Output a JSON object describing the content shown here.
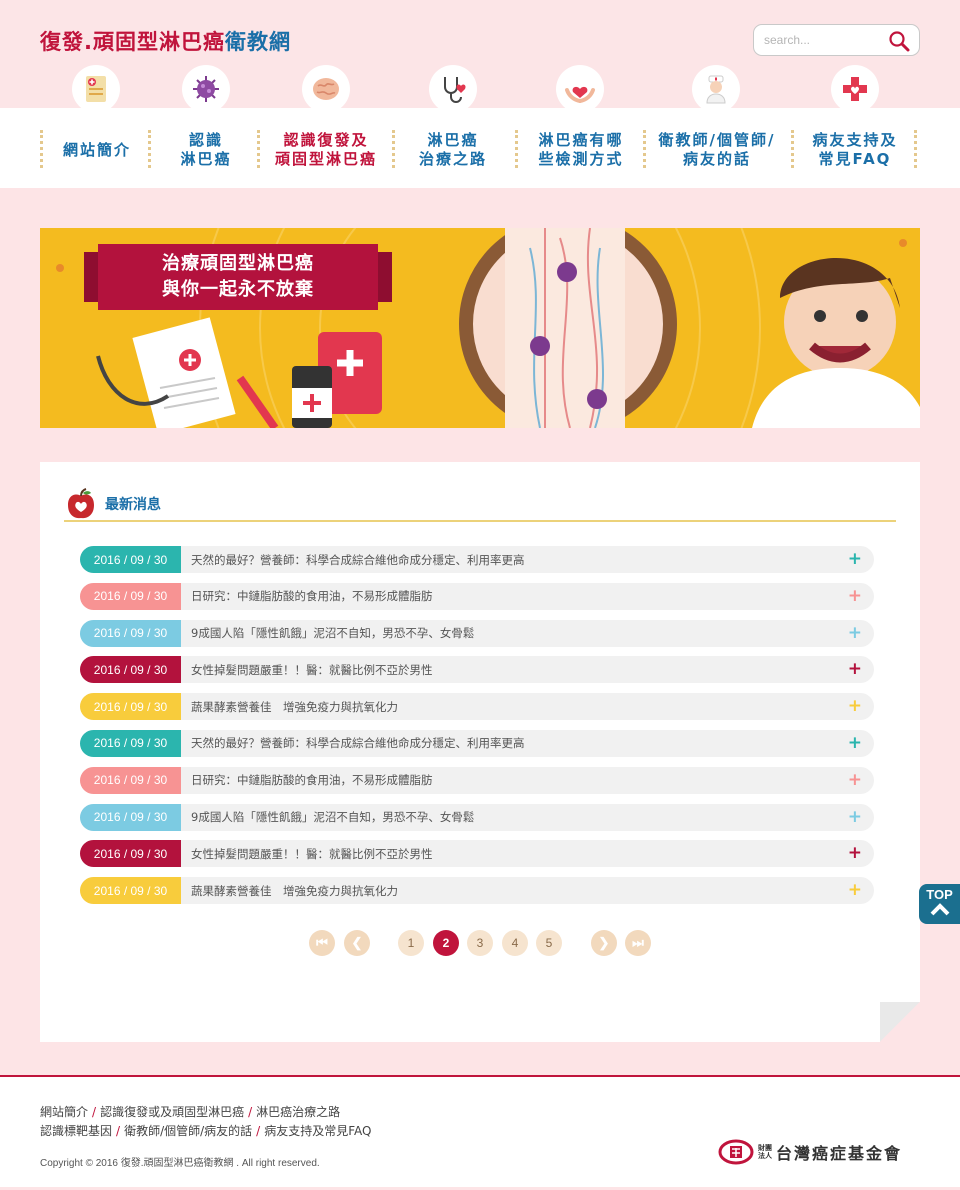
{
  "header": {
    "title_part1": "復發.頑固型淋巴癌",
    "title_part2": "衛教網",
    "search_placeholder": "search..."
  },
  "nav": {
    "icons": [
      "document-icon",
      "virus-icon",
      "brain-icon",
      "stethoscope-heart-icon",
      "hands-heart-icon",
      "nurse-icon",
      "medical-cross-icon"
    ],
    "items": [
      {
        "label": "網站簡介",
        "active": false
      },
      {
        "label": "認識\n淋巴癌",
        "active": false
      },
      {
        "label": "認識復發及\n頑固型淋巴癌",
        "active": true
      },
      {
        "label": "淋巴癌\n治療之路",
        "active": false
      },
      {
        "label": "淋巴癌有哪\n些檢測方式",
        "active": false
      },
      {
        "label": "衛教師/個管師/\n病友的話",
        "active": false
      },
      {
        "label": "病友支持及\n常見FAQ",
        "active": false
      }
    ]
  },
  "banner": {
    "line1": "治療頑固型淋巴癌",
    "line2": "與你一起永不放棄"
  },
  "news": {
    "title": "最新消息",
    "items": [
      {
        "date": "2016 / 09 / 30",
        "text": "天然的最好？營養師：科學合成綜合維他命成分穩定、利用率更高",
        "color": "#2bb5ae"
      },
      {
        "date": "2016 / 09 / 30",
        "text": "日研究：中鏈脂肪酸的食用油，不易形成體脂肪",
        "color": "#f79393"
      },
      {
        "date": "2016 / 09 / 30",
        "text": "9成國人陷「隱性飢餓」泥沼不自知，男恐不孕、女骨鬆",
        "color": "#7ccbe2"
      },
      {
        "date": "2016 / 09 / 30",
        "text": "女性掉髮問題嚴重！！醫：就醫比例不亞於男性",
        "color": "#b3123d"
      },
      {
        "date": "2016 / 09 / 30",
        "text": "蔬果酵素營養佳　增強免疫力與抗氧化力",
        "color": "#f8cc3c"
      },
      {
        "date": "2016 / 09 / 30",
        "text": "天然的最好？營養師：科學合成綜合維他命成分穩定、利用率更高",
        "color": "#2bb5ae"
      },
      {
        "date": "2016 / 09 / 30",
        "text": "日研究：中鏈脂肪酸的食用油，不易形成體脂肪",
        "color": "#f79393"
      },
      {
        "date": "2016 / 09 / 30",
        "text": "9成國人陷「隱性飢餓」泥沼不自知，男恐不孕、女骨鬆",
        "color": "#7ccbe2"
      },
      {
        "date": "2016 / 09 / 30",
        "text": "女性掉髮問題嚴重！！醫：就醫比例不亞於男性",
        "color": "#b3123d"
      },
      {
        "date": "2016 / 09 / 30",
        "text": "蔬果酵素營養佳　增強免疫力與抗氧化力",
        "color": "#f8cc3c"
      }
    ],
    "plus": "+"
  },
  "pagination": {
    "pages": [
      "1",
      "2",
      "3",
      "4",
      "5"
    ],
    "current": "2"
  },
  "top_button": {
    "label": "TOP"
  },
  "footer": {
    "links_row1": [
      "網站簡介",
      "認識復發或及頑固型淋巴癌",
      "淋巴癌治療之路"
    ],
    "links_row2": [
      "認識標靶基因",
      "衛教師/個管師/病友的話",
      "病友支持及常見FAQ"
    ],
    "separator": "/",
    "copyright": "Copyright © 2016 復發.頑固型淋巴癌衛教網 . All right reserved.",
    "foundation_small": "財團法人",
    "foundation_name": "台灣癌症基金會"
  }
}
